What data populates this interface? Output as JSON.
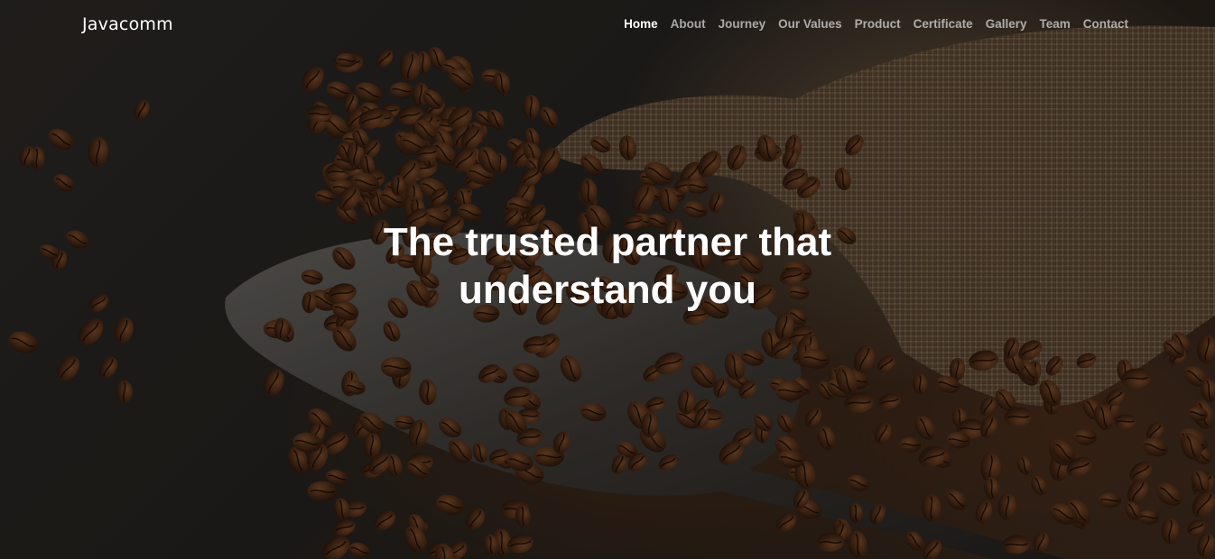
{
  "brand": {
    "name": "Javacomm"
  },
  "nav": {
    "items": [
      {
        "label": "Home",
        "active": true
      },
      {
        "label": "About",
        "active": false
      },
      {
        "label": "Journey",
        "active": false
      },
      {
        "label": "Our Values",
        "active": false
      },
      {
        "label": "Product",
        "active": false
      },
      {
        "label": "Certificate",
        "active": false
      },
      {
        "label": "Gallery",
        "active": false
      },
      {
        "label": "Team",
        "active": false
      },
      {
        "label": "Contact",
        "active": false
      }
    ]
  },
  "hero": {
    "headline_line1": "The trusted partner that",
    "headline_line2": "understand you",
    "background": "coffee-beans-scoop-and-burlap-sack-photo"
  },
  "colors": {
    "text_primary": "#ffffff",
    "nav_inactive": "#9e9a96",
    "background_dark": "#25221f",
    "bean_brown": "#4a2c1a"
  }
}
